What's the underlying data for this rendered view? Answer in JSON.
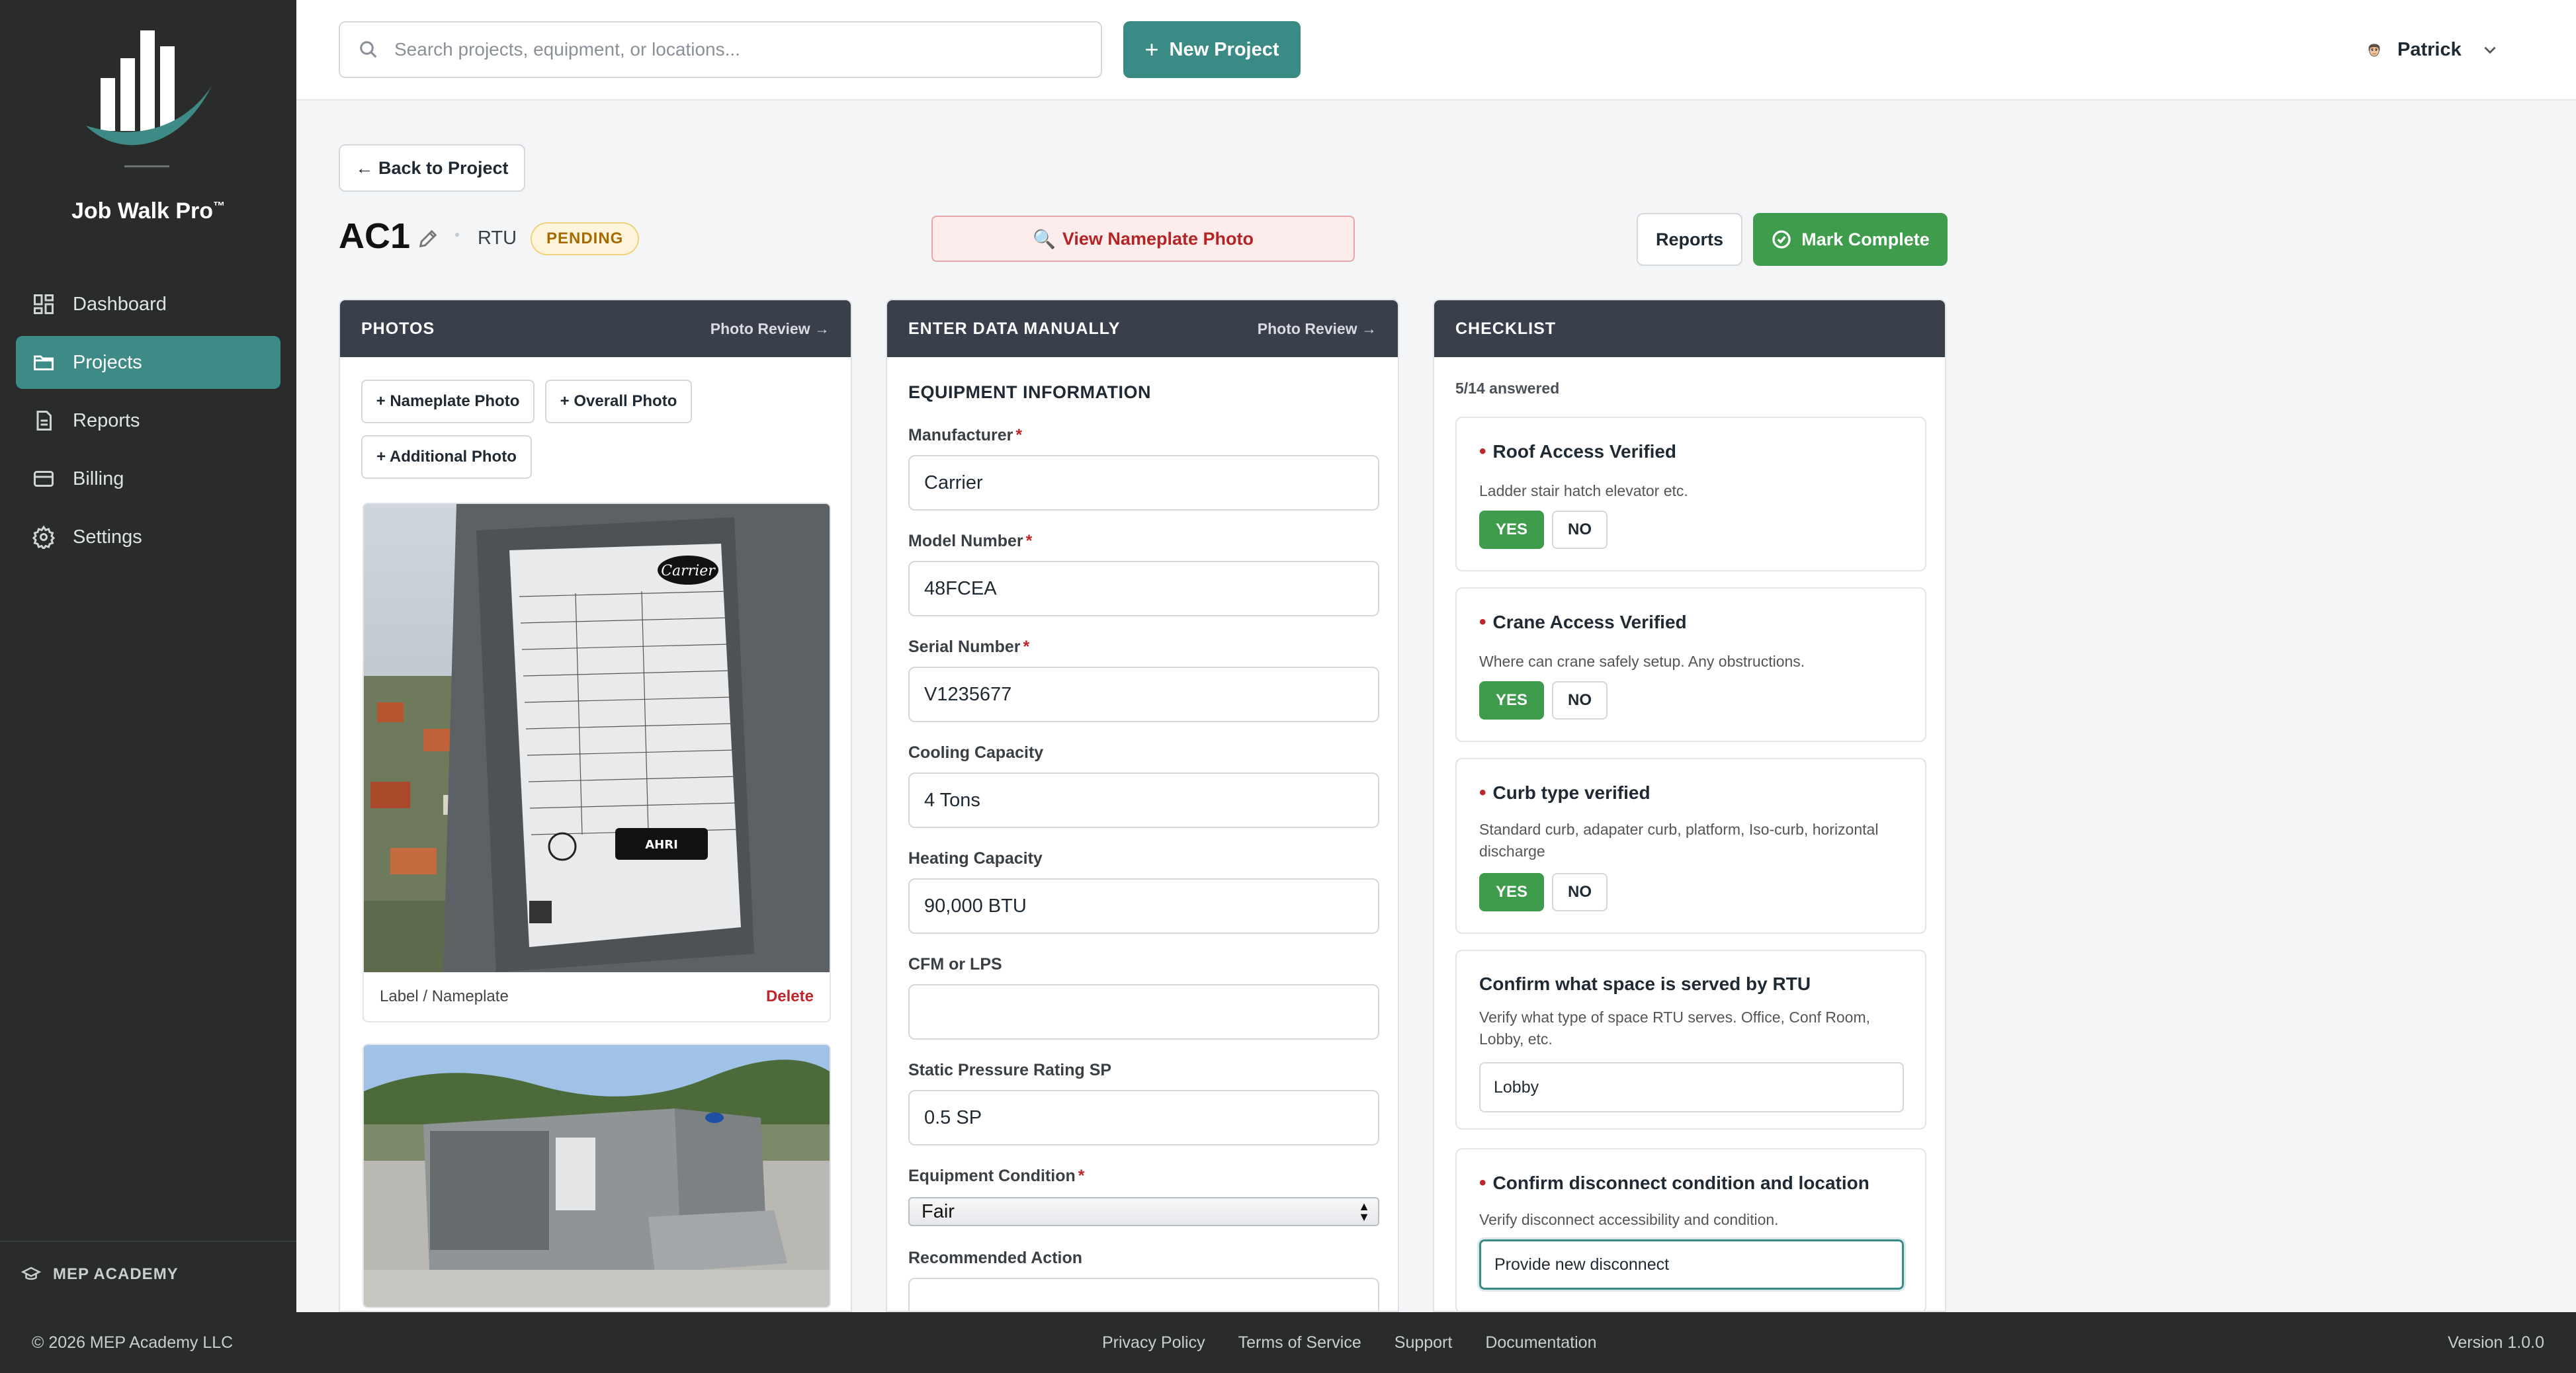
{
  "app": {
    "brand": "Job Walk Pro",
    "brand_mark": "™"
  },
  "sidebar": {
    "items": [
      {
        "label": "Dashboard",
        "icon": "dashboard-icon"
      },
      {
        "label": "Projects",
        "icon": "folder-icon",
        "active": true
      },
      {
        "label": "Reports",
        "icon": "document-icon"
      },
      {
        "label": "Billing",
        "icon": "credit-card-icon"
      },
      {
        "label": "Settings",
        "icon": "gear-icon"
      }
    ],
    "footer_label": "MEP ACADEMY"
  },
  "header": {
    "search_placeholder": "Search projects, equipment, or locations...",
    "new_project": "New Project",
    "user_name": "Patrick"
  },
  "page": {
    "back": "← Back to Project",
    "title": "AC1",
    "type": "RTU",
    "status": "PENDING",
    "view_nameplate": "View Nameplate Photo",
    "reports": "Reports",
    "mark_complete": "Mark Complete"
  },
  "photos_panel": {
    "title": "PHOTOS",
    "link": "Photo Review →",
    "buttons": [
      "+ Nameplate Photo",
      "+ Overall Photo",
      "+ Additional Photo"
    ],
    "photos": [
      {
        "caption": "Label / Nameplate",
        "delete": "Delete"
      },
      {
        "caption": "",
        "delete": ""
      }
    ]
  },
  "data_panel": {
    "title": "ENTER DATA MANUALLY",
    "link": "Photo Review →",
    "section": "EQUIPMENT INFORMATION",
    "fields": [
      {
        "label": "Manufacturer",
        "required": true,
        "value": "Carrier"
      },
      {
        "label": "Model Number",
        "required": true,
        "value": "48FCEA"
      },
      {
        "label": "Serial Number",
        "required": true,
        "value": "V1235677"
      },
      {
        "label": "Cooling Capacity",
        "required": false,
        "value": "4 Tons"
      },
      {
        "label": "Heating Capacity",
        "required": false,
        "value": "90,000 BTU"
      },
      {
        "label": "CFM or LPS",
        "required": false,
        "value": ""
      },
      {
        "label": "Static Pressure Rating SP",
        "required": false,
        "value": "0.5 SP"
      }
    ],
    "condition": {
      "label": "Equipment Condition",
      "value": "Fair"
    },
    "recommended": {
      "label": "Recommended Action",
      "value": ""
    }
  },
  "checklist": {
    "title": "CHECKLIST",
    "answered": "5/14 answered",
    "items": [
      {
        "title": "Roof Access Verified",
        "desc": "Ladder stair hatch elevator etc.",
        "yes": "YES",
        "no": "NO",
        "answer": "yes"
      },
      {
        "title": "Crane Access Verified",
        "desc": "Where can crane safely setup. Any obstructions.",
        "yes": "YES",
        "no": "NO",
        "answer": "yes"
      },
      {
        "title": "Curb type verified",
        "desc": "Standard curb, adapater curb, platform, Iso-curb, horizontal discharge",
        "yes": "YES",
        "no": "NO",
        "answer": "yes"
      },
      {
        "title": "Confirm what space is served by RTU",
        "desc": "Verify what type of space RTU serves. Office, Conf Room, Lobby, etc.",
        "value": "Lobby"
      },
      {
        "title": "Confirm disconnect condition and location",
        "desc": "Verify disconnect accessibility and condition.",
        "value": "Provide new disconnect"
      }
    ]
  },
  "footer": {
    "copyright": "© 2026 MEP Academy LLC",
    "links": [
      "Privacy Policy",
      "Terms of Service",
      "Support",
      "Documentation"
    ],
    "version": "Version 1.0.0"
  },
  "colors": {
    "accent": "#3a8a85",
    "success": "#3f9c4c",
    "danger": "#c0252a",
    "sidebar": "#2a2c2c",
    "panel_header": "#3a3f4c"
  }
}
